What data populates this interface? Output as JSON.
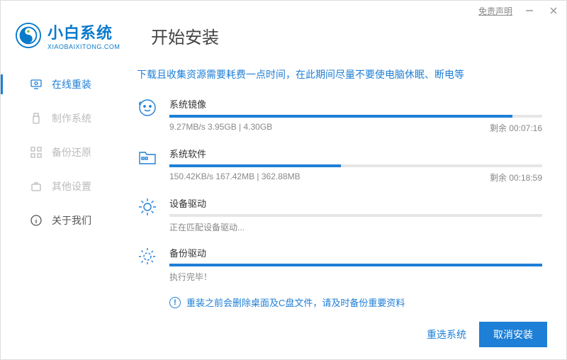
{
  "titlebar": {
    "disclaimer": "免责声明"
  },
  "brand": {
    "name": "小白系统",
    "domain": "XIAOBAIXITONG.COM"
  },
  "page_title": "开始安装",
  "nav": [
    {
      "label": "在线重装",
      "active": true
    },
    {
      "label": "制作系统",
      "active": false
    },
    {
      "label": "备份还原",
      "active": false
    },
    {
      "label": "其他设置",
      "active": false
    },
    {
      "label": "关于我们",
      "active": false
    }
  ],
  "notice": "下载且收集资源需要耗费一点时间，在此期间尽量不要使电脑休眠、断电等",
  "tasks": [
    {
      "title": "系统镜像",
      "progress": 92,
      "left": "9.27MB/s 3.95GB | 4.30GB",
      "right": "剩余 00:07:16"
    },
    {
      "title": "系统软件",
      "progress": 46,
      "left": "150.42KB/s 167.42MB | 362.88MB",
      "right": "剩余 00:18:59"
    },
    {
      "title": "设备驱动",
      "progress": 0,
      "left": "正在匹配设备驱动...",
      "right": ""
    },
    {
      "title": "备份驱动",
      "progress": 100,
      "left": "执行完毕！",
      "right": ""
    }
  ],
  "warning": "重装之前会删除桌面及C盘文件，请及时备份重要资料",
  "footer": {
    "reselect": "重选系统",
    "cancel": "取消安装"
  }
}
